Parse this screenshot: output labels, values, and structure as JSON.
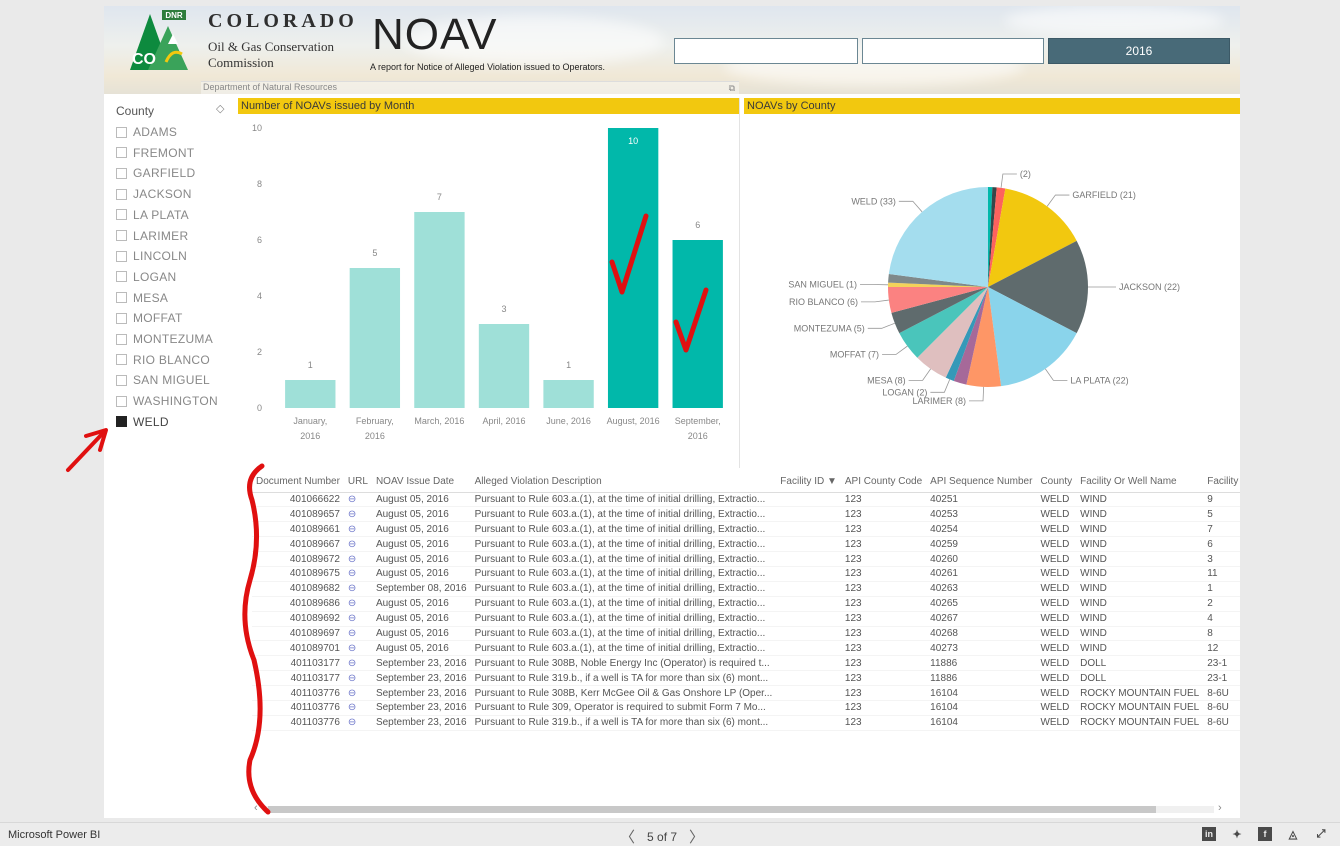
{
  "header": {
    "logo_dnr": "DNR",
    "logo_co": "CO",
    "org_name": "COLORADO",
    "org_sub1": "Oil & Gas Conservation",
    "org_sub2": "Commission",
    "dept": "Department of Natural Resources",
    "report_title": "NOAV",
    "report_subtitle": "A report for Notice of Alleged Violation issued to Operators.",
    "year_button": "2016"
  },
  "slicer": {
    "title": "County",
    "items": [
      {
        "label": "ADAMS",
        "checked": false
      },
      {
        "label": "FREMONT",
        "checked": false
      },
      {
        "label": "GARFIELD",
        "checked": false
      },
      {
        "label": "JACKSON",
        "checked": false
      },
      {
        "label": "LA PLATA",
        "checked": false
      },
      {
        "label": "LARIMER",
        "checked": false
      },
      {
        "label": "LINCOLN",
        "checked": false
      },
      {
        "label": "LOGAN",
        "checked": false
      },
      {
        "label": "MESA",
        "checked": false
      },
      {
        "label": "MOFFAT",
        "checked": false
      },
      {
        "label": "MONTEZUMA",
        "checked": false
      },
      {
        "label": "RIO BLANCO",
        "checked": false
      },
      {
        "label": "SAN MIGUEL",
        "checked": false
      },
      {
        "label": "WASHINGTON",
        "checked": false
      },
      {
        "label": "WELD",
        "checked": true
      }
    ]
  },
  "bar_chart": {
    "title": "Number of NOAVs issued by Month"
  },
  "pie_chart": {
    "title": "NOAVs by County"
  },
  "chart_data": [
    {
      "type": "bar",
      "title": "Number of NOAVs issued by Month",
      "categories": [
        "January, 2016",
        "February, 2016",
        "March, 2016",
        "April, 2016",
        "June, 2016",
        "August, 2016",
        "September, 2016"
      ],
      "category_lines": [
        [
          "January,",
          "2016"
        ],
        [
          "February,",
          "2016"
        ],
        [
          "March, 2016"
        ],
        [
          "April, 2016"
        ],
        [
          "June, 2016"
        ],
        [
          "August, 2016"
        ],
        [
          "September,",
          "2016"
        ]
      ],
      "values": [
        1,
        5,
        7,
        3,
        1,
        10,
        6
      ],
      "highlighted": [
        false,
        false,
        false,
        false,
        false,
        true,
        true
      ],
      "ylim": [
        0,
        10
      ],
      "yticks": [
        0,
        2,
        4,
        6,
        8,
        10
      ],
      "colors": {
        "normal": "#9fe0d8",
        "highlight": "#01b8aa"
      }
    },
    {
      "type": "pie",
      "title": "NOAVs by County",
      "slices": [
        {
          "label": "",
          "value": 1,
          "color": "#01b8aa"
        },
        {
          "label": "",
          "value": 1,
          "color": "#374649"
        },
        {
          "label": "(2)",
          "value": 2,
          "color": "#fd625e"
        },
        {
          "label": "GARFIELD (21)",
          "value": 21,
          "color": "#f2c80f"
        },
        {
          "label": "JACKSON (22)",
          "value": 22,
          "color": "#5f6b6d"
        },
        {
          "label": "LA PLATA (22)",
          "value": 22,
          "color": "#8ad4eb"
        },
        {
          "label": "LARIMER (8)",
          "value": 8,
          "color": "#fe9666"
        },
        {
          "label": "",
          "value": 3,
          "color": "#a66999"
        },
        {
          "label": "LOGAN (2)",
          "value": 2,
          "color": "#3599b8"
        },
        {
          "label": "MESA (8)",
          "value": 8,
          "color": "#dfbfbf"
        },
        {
          "label": "MOFFAT (7)",
          "value": 7,
          "color": "#4ac5bb"
        },
        {
          "label": "MONTEZUMA (5)",
          "value": 5,
          "color": "#5f6b6d"
        },
        {
          "label": "RIO BLANCO (6)",
          "value": 6,
          "color": "#fb8281"
        },
        {
          "label": "SAN MIGUEL (1)",
          "value": 1,
          "color": "#f4d25a"
        },
        {
          "label": "",
          "value": 2,
          "color": "#7f898a"
        },
        {
          "label": "WELD (33)",
          "value": 33,
          "color": "#a4ddee"
        }
      ]
    }
  ],
  "table": {
    "columns": [
      "Document Number",
      "URL",
      "NOAV Issue Date",
      "Alleged Violation Description",
      "Facility ID",
      "API County Code",
      "API Sequence Number",
      "County",
      "Facility Or Well Name",
      "Facility Or"
    ],
    "sort_icon": "▼",
    "rows": [
      [
        "401066622",
        "August 05, 2016",
        "Pursuant to Rule 603.a.(1), at the time of initial drilling, Extractio...",
        "123",
        "40251",
        "WELD",
        "WIND",
        "9"
      ],
      [
        "401089657",
        "August 05, 2016",
        "Pursuant to Rule 603.a.(1), at the time of initial drilling, Extractio...",
        "123",
        "40253",
        "WELD",
        "WIND",
        "5"
      ],
      [
        "401089661",
        "August 05, 2016",
        "Pursuant to Rule 603.a.(1), at the time of initial drilling, Extractio...",
        "123",
        "40254",
        "WELD",
        "WIND",
        "7"
      ],
      [
        "401089667",
        "August 05, 2016",
        "Pursuant to Rule 603.a.(1), at the time of initial drilling, Extractio...",
        "123",
        "40259",
        "WELD",
        "WIND",
        "6"
      ],
      [
        "401089672",
        "August 05, 2016",
        "Pursuant to Rule 603.a.(1), at the time of initial drilling, Extractio...",
        "123",
        "40260",
        "WELD",
        "WIND",
        "3"
      ],
      [
        "401089675",
        "August 05, 2016",
        "Pursuant to Rule 603.a.(1), at the time of initial drilling, Extractio...",
        "123",
        "40261",
        "WELD",
        "WIND",
        "11"
      ],
      [
        "401089682",
        "September 08, 2016",
        "Pursuant to Rule 603.a.(1), at the time of initial drilling, Extractio...",
        "123",
        "40263",
        "WELD",
        "WIND",
        "1"
      ],
      [
        "401089686",
        "August 05, 2016",
        "Pursuant to Rule 603.a.(1), at the time of initial drilling, Extractio...",
        "123",
        "40265",
        "WELD",
        "WIND",
        "2"
      ],
      [
        "401089692",
        "August 05, 2016",
        "Pursuant to Rule 603.a.(1), at the time of initial drilling, Extractio...",
        "123",
        "40267",
        "WELD",
        "WIND",
        "4"
      ],
      [
        "401089697",
        "August 05, 2016",
        "Pursuant to Rule 603.a.(1), at the time of initial drilling, Extractio...",
        "123",
        "40268",
        "WELD",
        "WIND",
        "8"
      ],
      [
        "401089701",
        "August 05, 2016",
        "Pursuant to Rule 603.a.(1), at the time of initial drilling, Extractio...",
        "123",
        "40273",
        "WELD",
        "WIND",
        "12"
      ],
      [
        "401103177",
        "September 23, 2016",
        "Pursuant to Rule 308B, Noble Energy Inc (Operator) is required t...",
        "123",
        "11886",
        "WELD",
        "DOLL",
        "23-1"
      ],
      [
        "401103177",
        "September 23, 2016",
        "Pursuant to Rule 319.b., if a well is TA for more than six (6) mont...",
        "123",
        "11886",
        "WELD",
        "DOLL",
        "23-1"
      ],
      [
        "401103776",
        "September 23, 2016",
        "Pursuant to Rule 308B, Kerr McGee Oil & Gas Onshore LP (Oper...",
        "123",
        "16104",
        "WELD",
        "ROCKY MOUNTAIN FUEL",
        "8-6U"
      ],
      [
        "401103776",
        "September 23, 2016",
        "Pursuant to Rule 309, Operator is required to submit Form 7 Mo...",
        "123",
        "16104",
        "WELD",
        "ROCKY MOUNTAIN FUEL",
        "8-6U"
      ],
      [
        "401103776",
        "September 23, 2016",
        "Pursuant to Rule 319.b., if a well is TA for more than six (6) mont...",
        "123",
        "16104",
        "WELD",
        "ROCKY MOUNTAIN FUEL",
        "8-6U"
      ]
    ]
  },
  "bottom": {
    "brand": "Microsoft Power BI",
    "page_indicator": "5 of 7",
    "prev": "〈",
    "next": "〉"
  },
  "icons": {
    "url": "link-icon",
    "eraser": "eraser-icon",
    "focus": "focus-mode-icon",
    "share": [
      "linkedin-icon",
      "twitter-icon",
      "facebook-icon",
      "notifications-icon",
      "fullscreen-icon"
    ]
  }
}
